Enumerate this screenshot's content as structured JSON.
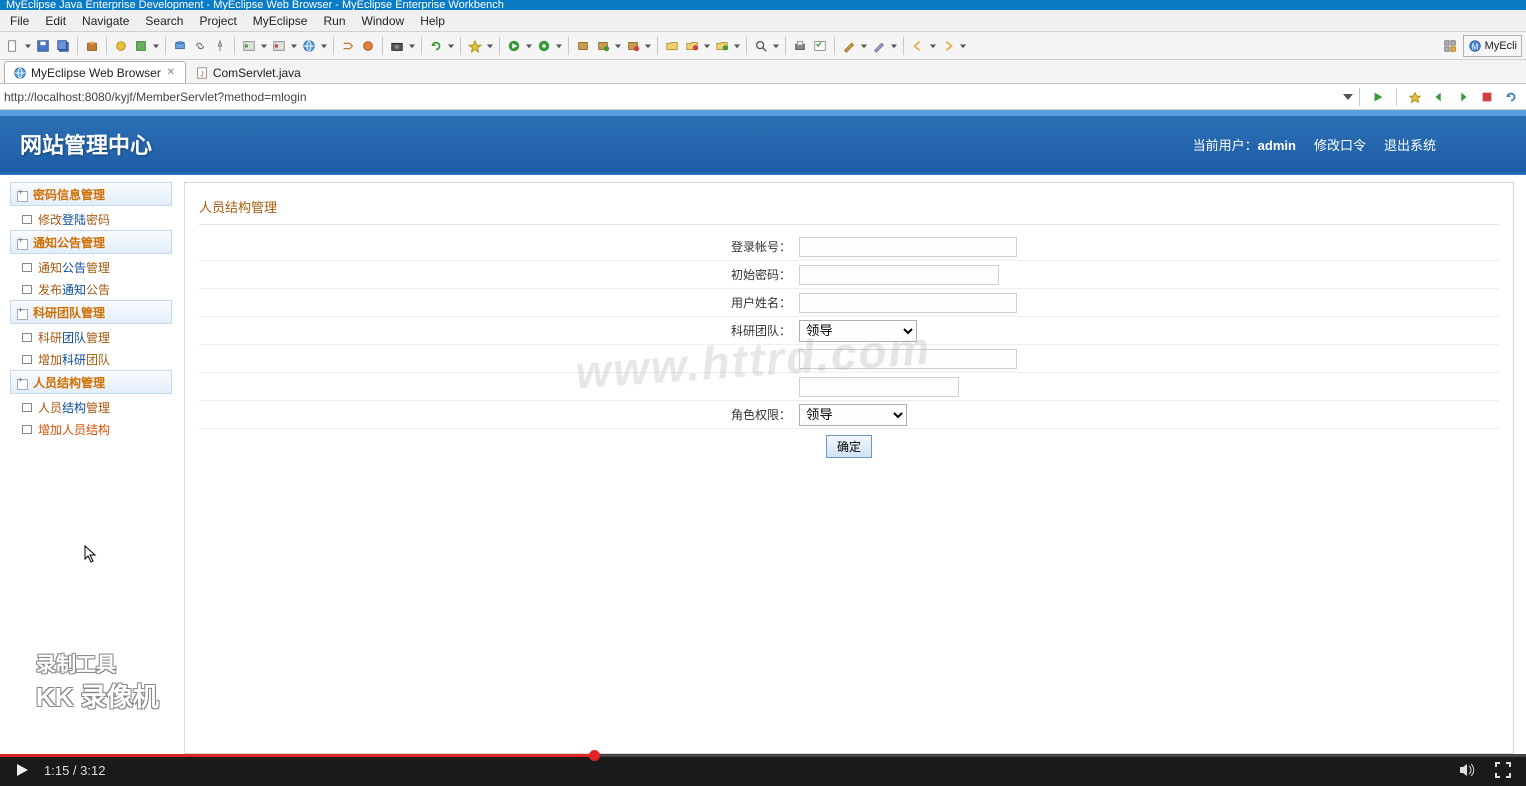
{
  "ide": {
    "titlebar": "MyEclipse Java Enterprise Development - MyEclipse Web Browser - MyEclipse Enterprise Workbench",
    "menu": [
      "File",
      "Edit",
      "Navigate",
      "Search",
      "Project",
      "MyEclipse",
      "Run",
      "Window",
      "Help"
    ],
    "perspective_label": "MyEcli",
    "tabs": [
      {
        "label": "MyEclipse Web Browser",
        "active": true,
        "closable": true
      },
      {
        "label": "ComServlet.java",
        "active": false,
        "closable": false
      }
    ],
    "url": "http://localhost:8080/kyjf/MemberServlet?method=mlogin"
  },
  "site": {
    "title": "网站管理中心",
    "current_user_label": "当前用户：",
    "current_user_value": "admin",
    "link_change_pwd": "修改口令",
    "link_logout": "退出系统",
    "sidebar": [
      {
        "type": "header",
        "label": "密码信息管理"
      },
      {
        "type": "item",
        "label_pre": "修改",
        "label_mid": "登陆",
        "label_post": "密码"
      },
      {
        "type": "header",
        "label": "通知公告管理"
      },
      {
        "type": "item",
        "label_pre": "通知",
        "label_mid": "公告",
        "label_post": "管理"
      },
      {
        "type": "item",
        "label_pre": "发布",
        "label_mid": "通知",
        "label_post": "公告"
      },
      {
        "type": "header",
        "label": "科研团队管理"
      },
      {
        "type": "item",
        "label_pre": "科研",
        "label_mid": "团队",
        "label_post": "管理"
      },
      {
        "type": "item",
        "label_pre": "增加",
        "label_mid": "科研",
        "label_post": "团队"
      },
      {
        "type": "header",
        "label": "人员结构管理"
      },
      {
        "type": "item",
        "label_pre": "人员",
        "label_mid": "结构",
        "label_post": "管理"
      },
      {
        "type": "item",
        "label_pre": "增加",
        "label_mid": "人员",
        "label_post": "结构",
        "active": true
      }
    ],
    "panel_title": "人员结构管理",
    "form": {
      "login_label": "登录帐号：",
      "initpwd_label": "初始密码：",
      "username_label": "用户姓名：",
      "team_label": "科研团队：",
      "team_value": "领导",
      "blank1_label": "",
      "role_label": "角色权限：",
      "role_value": "领导",
      "submit": "确定"
    },
    "watermark": "www.httrd.com",
    "recorder_l1": "录制工具",
    "recorder_l2": "KK 录像机"
  },
  "video": {
    "current": "1:15",
    "total": "3:12"
  }
}
